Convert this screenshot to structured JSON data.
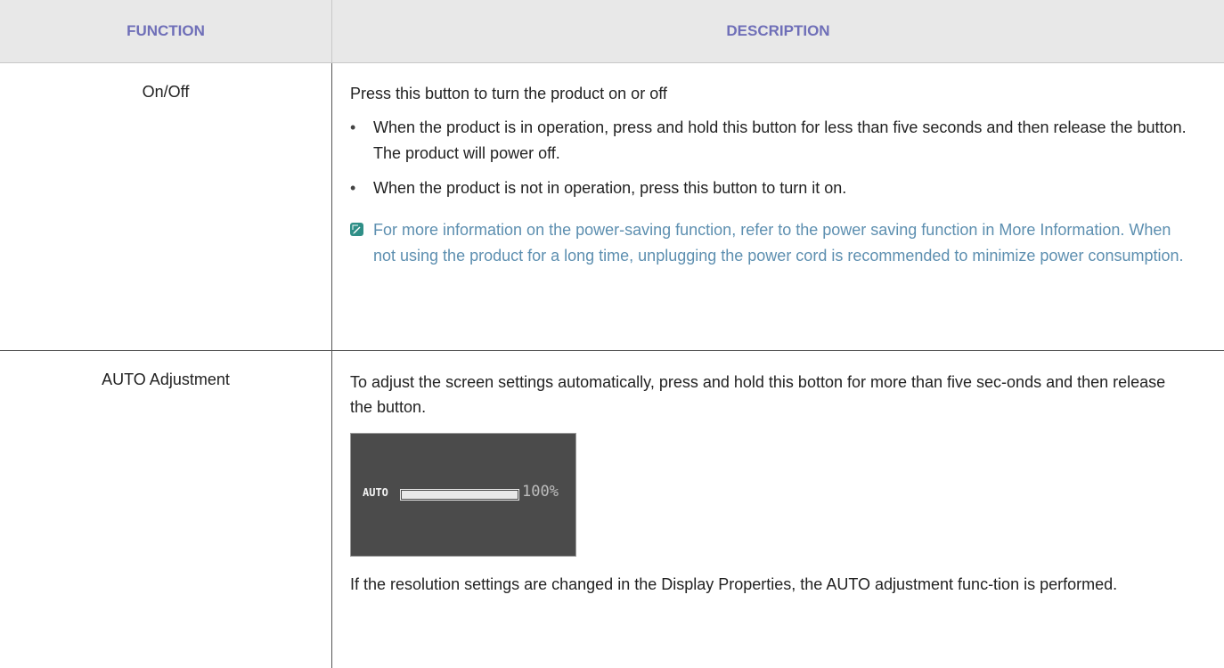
{
  "table": {
    "header": {
      "function": "FUNCTION",
      "description": "DESCRIPTION"
    },
    "rows": [
      {
        "function": "On/Off",
        "intro": "Press this button to turn the product on or off",
        "bullets": [
          "When the product is in operation, press and hold this button for less than five seconds and then release the button. The product will power off.",
          "When the product is not in operation, press this button to turn it on."
        ],
        "note": "For more information on the power-saving function, refer to the power saving function in More Information. When not using the product for a long time, unplugging the power cord is recommended to minimize power consumption."
      },
      {
        "function": "AUTO Adjustment",
        "intro": "To adjust the screen settings automatically, press and hold this botton for more than five sec-onds and then release the button.",
        "osd": {
          "label": "AUTO",
          "progress_percent": 100,
          "percent_text": "100%"
        },
        "outro": "If the resolution settings are changed in the Display Properties, the AUTO adjustment func-tion is performed."
      }
    ]
  },
  "colors": {
    "header_text": "#6f6fb8",
    "header_bg": "#e8e8e8",
    "note_text": "#5d8fb0",
    "note_icon": "#2f8f87",
    "osd_bg": "#4b4b4b"
  },
  "icons": {
    "note": "note-pencil-icon",
    "bullet": "bullet-dot"
  }
}
